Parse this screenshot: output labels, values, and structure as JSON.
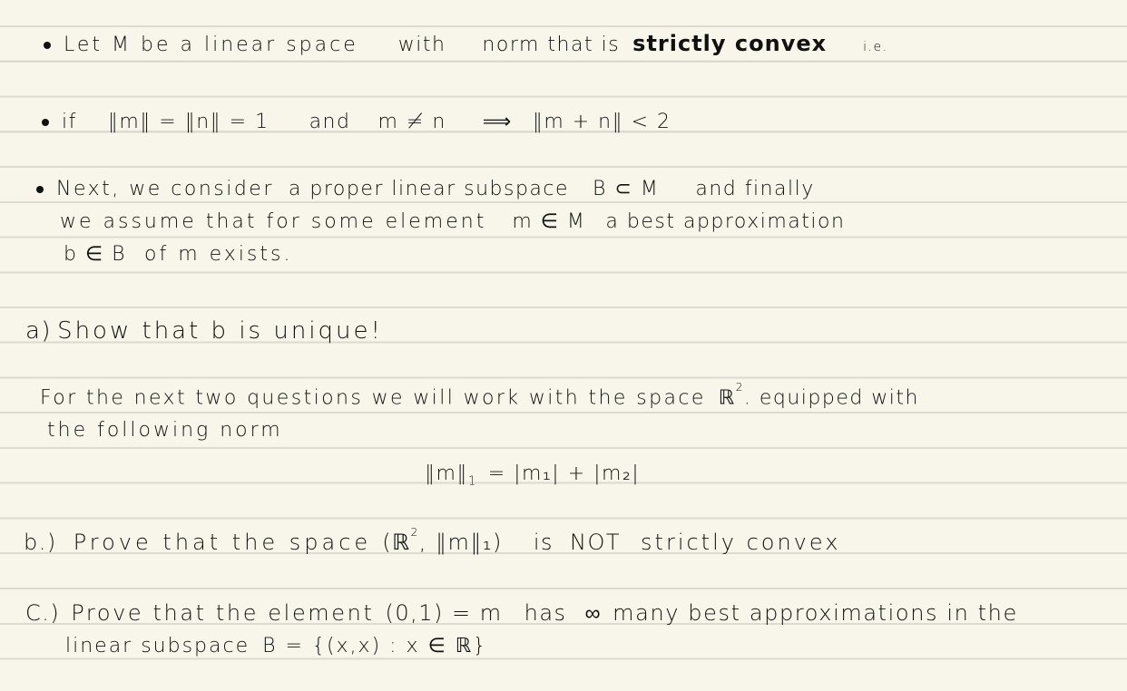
{
  "document": {
    "paper": {
      "background": "#f8f6ea",
      "rule_color": "#dcdbd3",
      "ink": "#111111"
    },
    "intro": {
      "line1": {
        "bullet": "bullet",
        "text_a": "Let M be a linear space",
        "text_b": "with",
        "text_c": "norm that is",
        "emphasis": "strictly convex",
        "text_d": "i.e."
      },
      "line2": {
        "bullet": "bullet",
        "text_a": "if",
        "formula_a": "‖m‖ = ‖n‖ = 1",
        "text_b": "and",
        "formula_b": "m ≠ n",
        "implies": "⟹",
        "formula_c": "‖m + n‖ < 2"
      },
      "line3": {
        "bullet": "bullet",
        "text_a": "Next, we consider",
        "text_b": "a proper linear subspace",
        "formula_a": "B ⊂ M",
        "text_c": "and finally",
        "cont1_a": "we assume that for some element",
        "cont1_formula": "m ∈ M",
        "cont1_b": "a best approximation",
        "cont2_formula": "b ∈ B",
        "cont2_text": "of m exists."
      }
    },
    "question_a": {
      "label": "a)",
      "text": "Show that b is unique!"
    },
    "context": {
      "text_a": "For the next two questions we will work with the space",
      "space": "ℝ",
      "space_exp": "2",
      "text_b": ". equipped with",
      "cont": "the following norm",
      "norm_formula_lhs": "‖m‖",
      "norm_formula_sub": "1",
      "norm_formula_rhs": "= |m₁| + |m₂|"
    },
    "question_b": {
      "label": "b.)",
      "text_a": "Prove that the space",
      "formula_open": "(ℝ",
      "formula_exp": "2",
      "formula_close": ", ‖m‖₁)",
      "text_b": "is",
      "emphasis": "NOT",
      "text_c": "strictly convex"
    },
    "question_c": {
      "label": "C.)",
      "text_a": "Prove that the element",
      "formula_a": "(0,1) = m",
      "text_b": "has",
      "infinity": "∞",
      "text_c": "many best approximations in the",
      "cont_a": "linear subspace",
      "cont_formula": "B = {(x,x) : x ∈ ℝ}"
    }
  }
}
